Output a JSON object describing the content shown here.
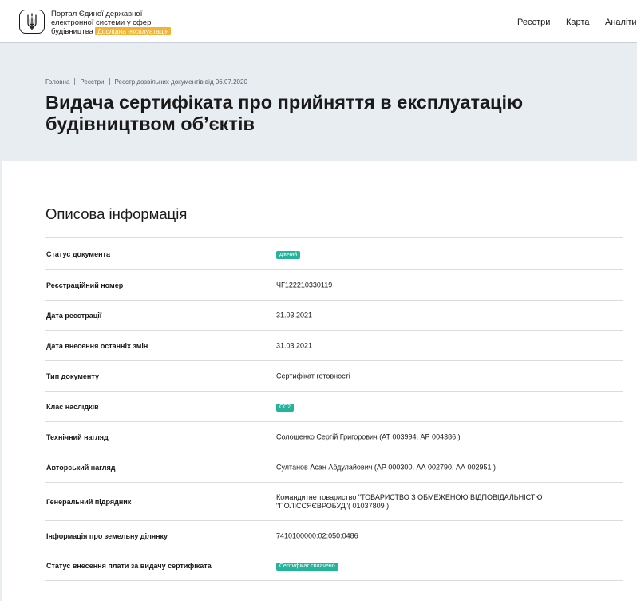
{
  "header": {
    "portal_line1": "Портал Єдиної державної",
    "portal_line2": "електронної системи у сфері",
    "portal_line3": "будівництва",
    "beta_badge": "Дослідна експлуатація",
    "nav": [
      "Реєстри",
      "Карта",
      "Аналіти"
    ]
  },
  "breadcrumbs": [
    "Головна",
    "Реєстри",
    "Реєстр дозвільних документів від 06.07.2020"
  ],
  "page_title_line1": "Видача сертифіката про прийняття в експлуатацію",
  "page_title_line2": "будівництвом об’єктів",
  "section_title": "Описова інформація",
  "rows": [
    {
      "label": "Статус документа",
      "value": "діючий"
    },
    {
      "label": "Реєстраційний номер",
      "value": "ЧГ122210330119"
    },
    {
      "label": "Дата реєстрації",
      "value": "31.03.2021"
    },
    {
      "label": "Дата внесення останніх змін",
      "value": "31.03.2021"
    },
    {
      "label": "Тип документу",
      "value": "Сертифікат готовності"
    },
    {
      "label": "Клас наслідків",
      "value": "СС2"
    },
    {
      "label": "Технічний нагляд",
      "value": "Солошенко Сергій Григорович (АТ 003994, АР 004386 )"
    },
    {
      "label": "Авторський нагляд",
      "value": "Султанов Асан Абдулайович (АР 000300, АА 002790, АА 002951 )"
    },
    {
      "label": "Генеральний підрядник",
      "value_line1": "Командитне товариство \"ТОВАРИСТВО З ОБМЕЖЕНОЮ ВІДПОВІДАЛЬНІСТЮ",
      "value_line2": "\"ПОЛІССЯЄВРОБУД\"( 01037809 )"
    },
    {
      "label": "Інформація про земельну ділянку",
      "value": "7410100000:02:050:0486"
    },
    {
      "label": "Статус внесення плати за видачу сертифіката",
      "value": "Сертифікат сплачено"
    }
  ],
  "colors": {
    "badge_green": "#26b39c",
    "beta_orange": "#f2b233",
    "hero_bg": "#e8edf2"
  },
  "icons": {
    "logo": "ukraine-trident-icon"
  }
}
